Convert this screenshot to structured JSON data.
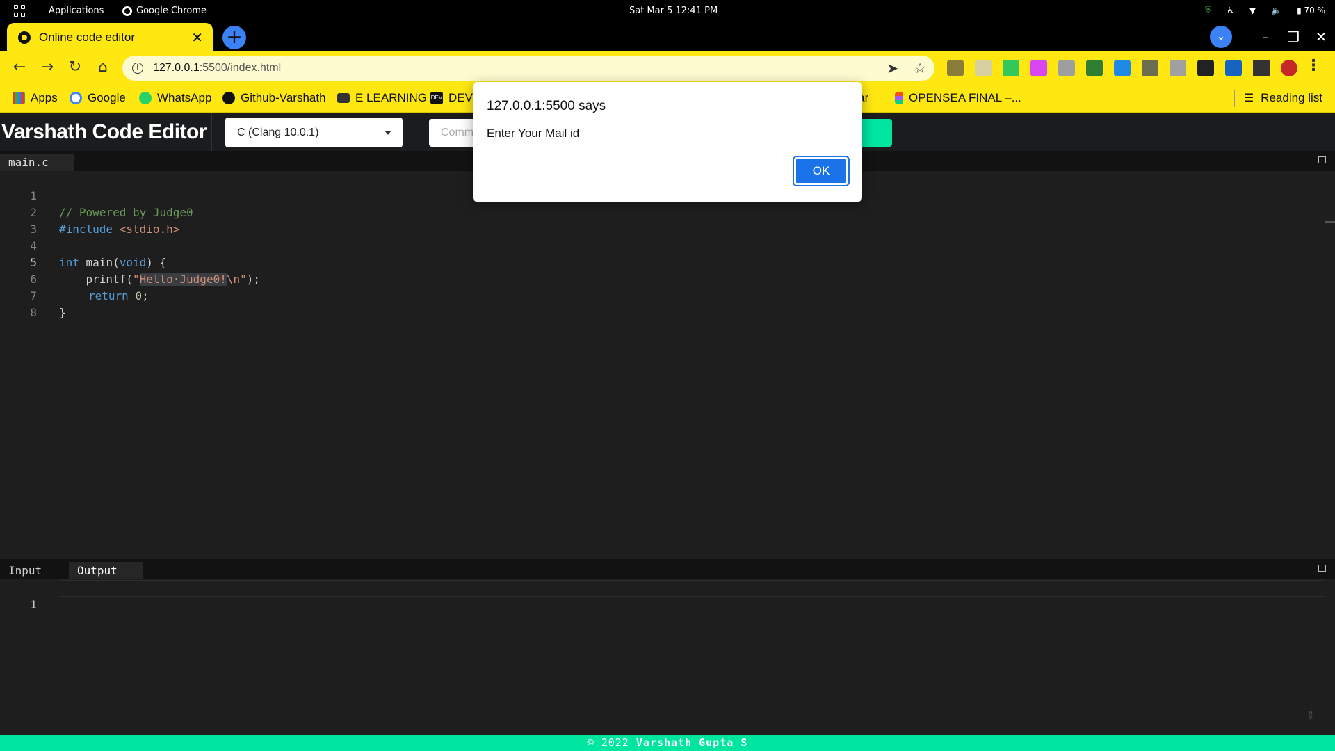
{
  "os": {
    "apps_label": "Applications",
    "chrome_label": "Google Chrome",
    "clock": "Sat Mar 5  12:41 PM",
    "battery": "70 %"
  },
  "browser": {
    "tab_title": "Online code editor",
    "url_host": "127.0.0.1",
    "url_path": ":5500/index.html",
    "bookmarks": [
      "Apps",
      "Google",
      "WhatsApp",
      "Github-Varshath",
      "E LEARNING",
      "DEV",
      "taar",
      "OPENSEA FINAL –..."
    ],
    "reading_list": "Reading list"
  },
  "app": {
    "title": "Varshath Code Editor",
    "language": "C (Clang 10.0.1)",
    "command_placeholder": "Comm",
    "editor_tab": "main.c",
    "io_tabs": [
      "Input",
      "Output"
    ],
    "io_line_number": "1",
    "footer_prefix": "© 2022 ",
    "footer_author": "Varshath Gupta S"
  },
  "code": {
    "lines": [
      "1",
      "2",
      "3",
      "4",
      "5",
      "6",
      "7",
      "8"
    ],
    "l1_comment": "// Powered by Judge0",
    "l2_include": "#include",
    "l2_header": " <stdio.h>",
    "l4_int": "int",
    "l4_main": " main(",
    "l4_void": "void",
    "l4_rest": ") {",
    "l5_pre": "    printf(",
    "l5_q1": "\"",
    "l5_str": "Hello·Judge0!",
    "l5_esc": "\\n\"",
    "l5_post": ");",
    "l6_return": "return",
    "l6_num": "0",
    "l6_post": ";",
    "l7": "}"
  },
  "dialog": {
    "title": "127.0.0.1:5500 says",
    "message": "Enter Your Mail id",
    "ok_label": "OK"
  },
  "colors": {
    "chrome_theme": "#ffe812",
    "accent_green": "#00e5a0",
    "dialog_button": "#1a73e8"
  }
}
